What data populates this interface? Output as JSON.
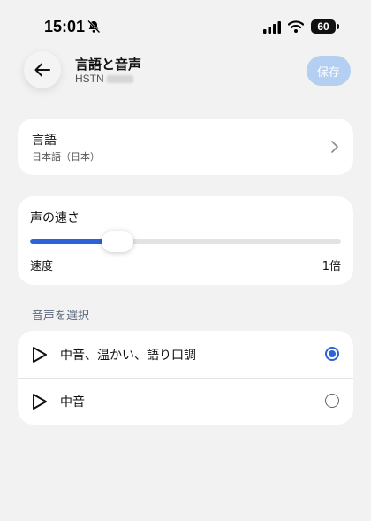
{
  "status_bar": {
    "time": "15:01",
    "battery": "60"
  },
  "header": {
    "title": "言語と音声",
    "subtitle": "HSTN",
    "save_label": "保存"
  },
  "language": {
    "label": "言語",
    "value": "日本語（日本）"
  },
  "speed": {
    "label": "声の速さ",
    "caption": "速度",
    "value_text": "1倍",
    "slider_fraction": 0.28
  },
  "voices": {
    "section_label": "音声を選択",
    "items": [
      {
        "name": "中音、温かい、語り口調",
        "selected": true
      },
      {
        "name": "中音",
        "selected": false
      }
    ]
  },
  "colors": {
    "accent": "#2e62d8",
    "save_disabled": "#b3cff2",
    "background": "#f2f2f3"
  }
}
